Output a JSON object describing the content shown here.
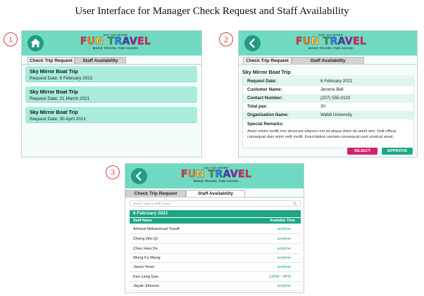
{
  "doc_title": "User Interface for Manager Check Request and Staff Availability",
  "markers": [
    "1",
    "2",
    "3"
  ],
  "logo": {
    "tagline_top": "SAY NO MORE",
    "letters": [
      "F",
      "U",
      "N",
      " ",
      "T",
      "R",
      "A",
      "V",
      "E",
      "L"
    ],
    "letter_colors": [
      "#e53935",
      "#fb8c00",
      "#fdd835",
      "#ffffff",
      "#43a047",
      "#1e88e5",
      "#3949ab",
      "#8e24aa",
      "#e91e63",
      "#e53935"
    ],
    "tagline_bottom": "MAKE TRAVEL FUN AGAIN!"
  },
  "colors": {
    "header": "#6fd9c1",
    "icon_circle": "#219c82",
    "card": "#a9ecdc",
    "reject": "#d3206f",
    "approve": "#22a888",
    "table_header": "#1ea584",
    "time_text": "#23a180"
  },
  "tabs": {
    "check_trip": "Check Trip Request",
    "staff_availability": "Staff Availability"
  },
  "screen1": {
    "header_icon": "home-icon",
    "requests": [
      {
        "title": "Sky Mirror Boat Trip",
        "date": "Request Date: 6 February 2021"
      },
      {
        "title": "Sky Mirror Boat Trip",
        "date": "Request Date: 21 March 2021"
      },
      {
        "title": "Sky Mirror Boat Trip",
        "date": "Request Date: 30 April 2021"
      }
    ]
  },
  "screen2": {
    "header_icon": "back-arrow-icon",
    "title": "Sky Mirror Boat Trip",
    "fields": [
      {
        "key": "Request Date:",
        "value": "6 February 2021"
      },
      {
        "key": "Customer Name:",
        "value": "Jerome Bell"
      },
      {
        "key": "Contact Number:",
        "value": "(207) 555-0119"
      },
      {
        "key": "Total pax:",
        "value": "30"
      },
      {
        "key": "Organisation Name:",
        "value": "Webb University"
      }
    ],
    "remarks_label": "Special Remarks:",
    "remarks_text": "Amet minim mollit non deserunt ullamco est sit aliqua dolor do amet sint. Velit officia consequat duis enim velit mollit. Exercitation veniam consequat sunt nostrud amet.",
    "reject_label": "REJECT",
    "approve_label": "APPROVE"
  },
  "screen3": {
    "header_icon": "back-arrow-icon",
    "search_placeholder": "search date or staff name",
    "date_heading": "6 February 2021",
    "col_staff": "Staff Name",
    "col_time": "Available Time",
    "staff": [
      {
        "name": "Ahmed Mohammad Yusoff",
        "time": "anytime"
      },
      {
        "name": "Cheng Wei Qi",
        "time": "anytime"
      },
      {
        "name": "Cheu Hwa De",
        "time": "anytime"
      },
      {
        "name": "Wong Fu Weng",
        "time": "anytime"
      },
      {
        "name": "Jason Yeow",
        "time": "anytime"
      },
      {
        "name": "Kee Leng Gee",
        "time": "12PM - 4PM"
      },
      {
        "name": "Jayati Johnson",
        "time": "anytime"
      }
    ]
  }
}
